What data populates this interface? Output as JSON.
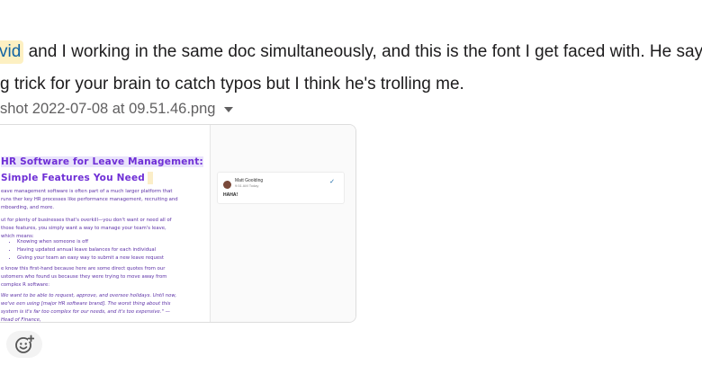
{
  "message": {
    "line1_mention": "vid",
    "line1_text": " and I working in the same doc simultaneously, and this is the font I get faced with. He says it's",
    "line2_text": "g trick for your brain to catch typos but I think he's trolling me."
  },
  "file": {
    "name": "shot 2022-07-08 at 09.51.46.png",
    "menu_icon": "caret-down-icon"
  },
  "preview": {
    "title_line1": "HR Software for Leave Management:",
    "title_line2": "Simple Features You Need",
    "para1": "eave management software is often part of a much larger platform that runs ther key HR processes like performance management, recruiting and mboarding, and more.",
    "para2": "ut for plenty of businesses that's overkill—you don't want or need all of those features, you simply want a way to manage your team's leave, which means:",
    "bullets": [
      "Knowing when someone is off",
      "Having updated annual leave balances for each individual",
      "Giving your team an easy way to submit a new leave request"
    ],
    "para3": "e know this first-hand because here are some direct quotes from our ustomers who found us because they were trying to move away from complex R software:",
    "quote": "We want to be able to request, approve, and oversee holidays. Until now, we've een using [major HR software brand]. The worst thing about this system is it's far too complex for our needs, and it's too expensive.\" — Head of Finance,",
    "comment": {
      "author": "Matt Goolding",
      "time": "9:51 AM Today",
      "text": "HAHA!"
    }
  },
  "reaction_button": {
    "icon": "add-reaction-icon"
  }
}
